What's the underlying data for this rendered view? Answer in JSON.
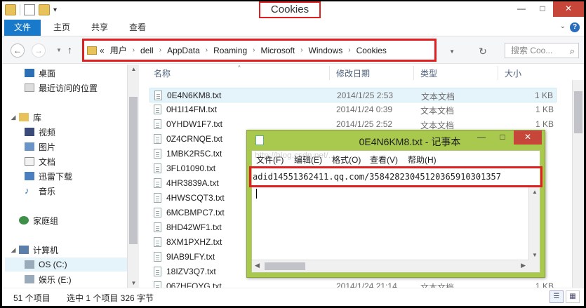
{
  "window": {
    "title": "Cookies",
    "controls": {
      "minimize": "—",
      "maximize": "□",
      "close": "✕"
    }
  },
  "ribbon": {
    "tabs": [
      "文件",
      "主页",
      "共享",
      "查看"
    ],
    "help": "?"
  },
  "address": {
    "overflow": "«",
    "crumbs": [
      "用户",
      "dell",
      "AppData",
      "Roaming",
      "Microsoft",
      "Windows",
      "Cookies"
    ],
    "search_placeholder": "搜索 Coo..."
  },
  "navpane": {
    "items": [
      {
        "label": "桌面",
        "icon": "desktop-icon"
      },
      {
        "label": "最近访问的位置",
        "icon": "recent-places-icon"
      },
      {
        "label": "库",
        "icon": "library-icon"
      },
      {
        "label": "视频",
        "icon": "video-icon"
      },
      {
        "label": "图片",
        "icon": "pictures-icon"
      },
      {
        "label": "文档",
        "icon": "documents-icon"
      },
      {
        "label": "迅雷下载",
        "icon": "thunder-download-icon"
      },
      {
        "label": "音乐",
        "icon": "music-icon"
      },
      {
        "label": "家庭组",
        "icon": "homegroup-icon"
      },
      {
        "label": "计算机",
        "icon": "computer-icon"
      },
      {
        "label": "OS (C:)",
        "icon": "drive-c-icon"
      },
      {
        "label": "娱乐 (E:)",
        "icon": "drive-e-icon"
      }
    ]
  },
  "filelist": {
    "columns": {
      "name": "名称",
      "date": "修改日期",
      "type": "类型",
      "size": "大小"
    },
    "rows": [
      {
        "name": "0E4N6KM8.txt",
        "date": "2014/1/25 2:53",
        "type": "文本文档",
        "size": "1 KB",
        "selected": true
      },
      {
        "name": "0H1I14FM.txt",
        "date": "2014/1/24 0:39",
        "type": "文本文档",
        "size": "1 KB"
      },
      {
        "name": "0YHDW1F7.txt",
        "date": "2014/1/25 2:52",
        "type": "文本文档",
        "size": "1 KB"
      },
      {
        "name": "0Z4CRNQE.txt",
        "date": "",
        "type": "",
        "size": ""
      },
      {
        "name": "1MBK2R5C.txt",
        "date": "",
        "type": "",
        "size": ""
      },
      {
        "name": "3FL01090.txt",
        "date": "",
        "type": "",
        "size": ""
      },
      {
        "name": "4HR3839A.txt",
        "date": "",
        "type": "",
        "size": ""
      },
      {
        "name": "4HWSCQT3.txt",
        "date": "",
        "type": "",
        "size": ""
      },
      {
        "name": "6MCBMPC7.txt",
        "date": "",
        "type": "",
        "size": ""
      },
      {
        "name": "8HD42WF1.txt",
        "date": "",
        "type": "",
        "size": ""
      },
      {
        "name": "8XM1PXHZ.txt",
        "date": "",
        "type": "",
        "size": ""
      },
      {
        "name": "9IAB9LFY.txt",
        "date": "",
        "type": "",
        "size": ""
      },
      {
        "name": "18IZV3Q7.txt",
        "date": "",
        "type": "",
        "size": ""
      },
      {
        "name": "067HFOYG.txt",
        "date": "2014/1/24 21:14",
        "type": "文本文档",
        "size": "1 KB"
      }
    ]
  },
  "status": {
    "count": "51 个项目",
    "selection": "选中 1 个项目  326 字节"
  },
  "notepad": {
    "title": "0E4N6KM8.txt - 记事本",
    "menu": [
      "文件(F)",
      "编辑(E)",
      "格式(O)",
      "查看(V)",
      "帮助(H)"
    ],
    "content": "adid14551362411.qq.com/3584282304512036591030135",
    "trailing_char": "7",
    "controls": {
      "minimize": "—",
      "maximize": "□",
      "close": "✕"
    }
  },
  "watermark": "http://blog.csdn.net/..."
}
